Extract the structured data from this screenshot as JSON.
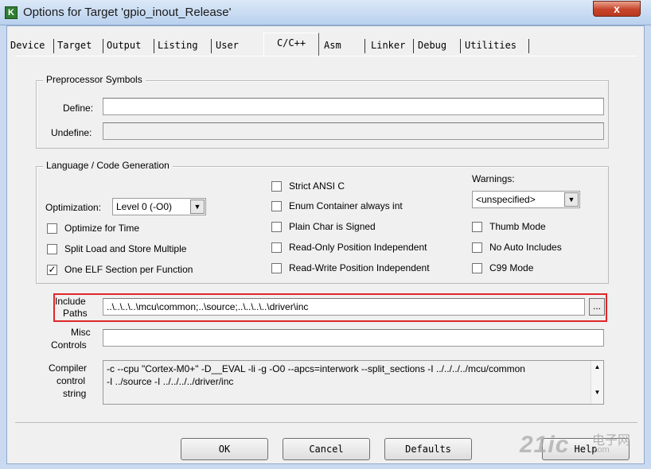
{
  "window": {
    "title": "Options for Target 'gpio_inout_Release'",
    "close_label": "x"
  },
  "tabs": [
    {
      "label": "Device"
    },
    {
      "label": "Target"
    },
    {
      "label": "Output"
    },
    {
      "label": "Listing"
    },
    {
      "label": "User"
    },
    {
      "label": "C/C++",
      "active": true
    },
    {
      "label": "Asm"
    },
    {
      "label": "Linker"
    },
    {
      "label": "Debug"
    },
    {
      "label": "Utilities"
    }
  ],
  "preprocessor": {
    "title": "Preprocessor Symbols",
    "define_label": "Define:",
    "define_value": "",
    "undefine_label": "Undefine:",
    "undefine_value": ""
  },
  "language": {
    "title": "Language / Code Generation",
    "optimization_label": "Optimization:",
    "optimization_value": "Level 0 (-O0)",
    "warnings_label": "Warnings:",
    "warnings_value": "<unspecified>",
    "checkboxes": [
      {
        "label": "Optimize for Time",
        "checked": false
      },
      {
        "label": "Split Load and Store Multiple",
        "checked": false
      },
      {
        "label": "One ELF Section per Function",
        "checked": true
      },
      {
        "label": "Strict ANSI C",
        "checked": false
      },
      {
        "label": "Enum Container always int",
        "checked": false
      },
      {
        "label": "Plain Char is Signed",
        "checked": false
      },
      {
        "label": "Read-Only Position Independent",
        "checked": false
      },
      {
        "label": "Read-Write Position Independent",
        "checked": false
      },
      {
        "label": "Thumb Mode",
        "checked": false
      },
      {
        "label": "No Auto Includes",
        "checked": false
      },
      {
        "label": "C99 Mode",
        "checked": false
      }
    ],
    "check_mark": "✓"
  },
  "include": {
    "label_line1": "Include",
    "label_line2": "Paths",
    "value": "..\\..\\..\\..\\mcu\\common;..\\source;..\\..\\..\\..\\driver\\inc",
    "browse_label": "..."
  },
  "misc": {
    "label_line1": "Misc",
    "label_line2": "Controls",
    "value": ""
  },
  "compiler": {
    "label_line1": "Compiler",
    "label_line2": "control",
    "label_line3": "string",
    "line1": "-c --cpu \"Cortex-M0+\" -D__EVAL -li -g -O0 --apcs=interwork --split_sections -I ../../../../mcu/common",
    "line2": "-I ../source -I ../../../../driver/inc"
  },
  "buttons": {
    "ok": "OK",
    "cancel": "Cancel",
    "defaults": "Defaults",
    "help": "Help"
  },
  "watermark": {
    "text": "21ic",
    "sub": "电子网",
    "url": ".com"
  },
  "colors": {
    "highlight": "#e0262a",
    "close": "#c7442a"
  }
}
